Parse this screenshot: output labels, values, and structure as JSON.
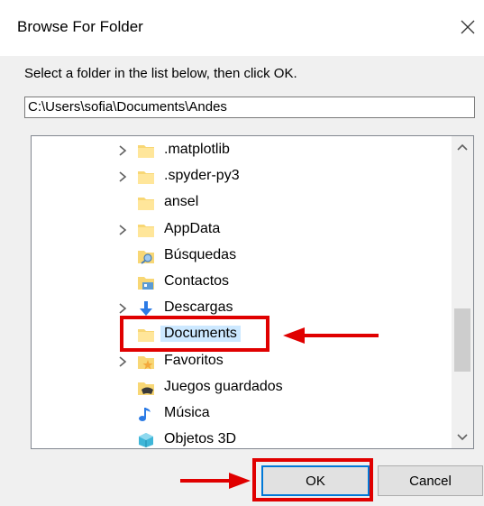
{
  "window": {
    "title": "Browse For Folder"
  },
  "instruction": "Select a folder in the list below, then click OK.",
  "path_value": "C:\\Users\\sofia\\Documents\\Andes",
  "tree": [
    {
      "label": ".matplotlib",
      "expandable": true,
      "icon": "folder-icon"
    },
    {
      "label": ".spyder-py3",
      "expandable": true,
      "icon": "folder-icon"
    },
    {
      "label": "ansel",
      "expandable": false,
      "icon": "folder-icon"
    },
    {
      "label": "AppData",
      "expandable": true,
      "icon": "folder-icon"
    },
    {
      "label": "Búsquedas",
      "expandable": false,
      "icon": "search-folder-icon"
    },
    {
      "label": "Contactos",
      "expandable": false,
      "icon": "contacts-folder-icon"
    },
    {
      "label": "Descargas",
      "expandable": true,
      "icon": "download-arrow-icon"
    },
    {
      "label": "Documents",
      "expandable": false,
      "icon": "folder-icon",
      "selected": true
    },
    {
      "label": "Favoritos",
      "expandable": true,
      "icon": "favorites-star-icon"
    },
    {
      "label": "Juegos guardados",
      "expandable": false,
      "icon": "saved-games-icon"
    },
    {
      "label": "Música",
      "expandable": false,
      "icon": "music-note-icon"
    },
    {
      "label": "Objetos 3D",
      "expandable": false,
      "icon": "3d-objects-icon"
    }
  ],
  "buttons": {
    "ok": "OK",
    "cancel": "Cancel"
  },
  "colors": {
    "highlight": "#e00000",
    "selection": "#cce8ff",
    "accent": "#0078d7"
  }
}
